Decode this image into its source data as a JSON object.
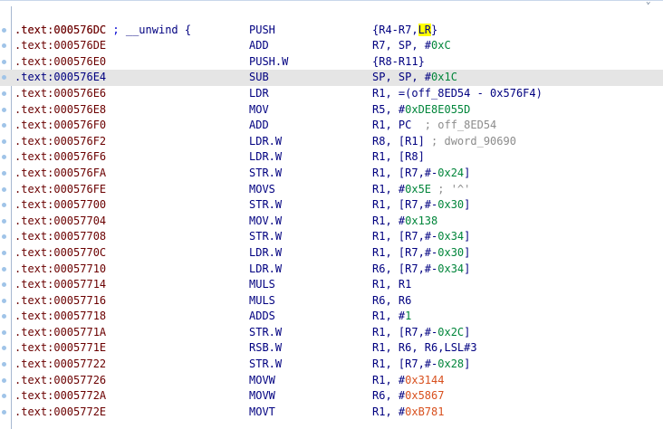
{
  "header_row": {
    "addr": ".text:000576DC",
    "sep": " ; ",
    "unwind": "__unwind {"
  },
  "rows": [
    {
      "addr": ".text:000576DC",
      "mnem": "PUSH",
      "op_a": "{R4-R7,",
      "op_lr": "LR",
      "op_b": "}"
    },
    {
      "addr": ".text:000576DE",
      "mnem": "ADD",
      "op_a": "R7, SP, #",
      "hex": "0xC"
    },
    {
      "addr": ".text:000576E0",
      "mnem": "PUSH.W",
      "op_a": "{R8-R11}"
    },
    {
      "addr": ".text:000576E4",
      "mnem": "SUB",
      "op_a": "SP, SP, #",
      "hex": "0x1C"
    },
    {
      "addr": ".text:000576E6",
      "mnem": "LDR",
      "op_a": "R1, =(off_8ED54 - 0x576F4)"
    },
    {
      "addr": ".text:000576E8",
      "mnem": "MOV",
      "op_a": "R5, #",
      "hex": "0xDE8E055D"
    },
    {
      "addr": ".text:000576F0",
      "mnem": "ADD",
      "op_a": "R1, PC",
      "comment": "  ; off_8ED54"
    },
    {
      "addr": ".text:000576F2",
      "mnem": "LDR.W",
      "op_a": "R8, [R1]",
      "comment": " ; dword_90690"
    },
    {
      "addr": ".text:000576F6",
      "mnem": "LDR.W",
      "op_a": "R1, [R8]"
    },
    {
      "addr": ".text:000576FA",
      "mnem": "STR.W",
      "op_a": "R1, [R7,#-",
      "hex": "0x24",
      "op_b": "]"
    },
    {
      "addr": ".text:000576FE",
      "mnem": "MOVS",
      "op_a": "R1, #",
      "hex": "0x5E",
      "comment": " ; '^'"
    },
    {
      "addr": ".text:00057700",
      "mnem": "STR.W",
      "op_a": "R1, [R7,#-",
      "hex": "0x30",
      "op_b": "]"
    },
    {
      "addr": ".text:00057704",
      "mnem": "MOV.W",
      "op_a": "R1, #",
      "hex": "0x138"
    },
    {
      "addr": ".text:00057708",
      "mnem": "STR.W",
      "op_a": "R1, [R7,#-",
      "hex": "0x34",
      "op_b": "]"
    },
    {
      "addr": ".text:0005770C",
      "mnem": "LDR.W",
      "op_a": "R1, [R7,#-",
      "hex": "0x30",
      "op_b": "]"
    },
    {
      "addr": ".text:00057710",
      "mnem": "LDR.W",
      "op_a": "R6, [R7,#-",
      "hex": "0x34",
      "op_b": "]"
    },
    {
      "addr": ".text:00057714",
      "mnem": "MULS",
      "op_a": "R1, R1"
    },
    {
      "addr": ".text:00057716",
      "mnem": "MULS",
      "op_a": "R6, R6"
    },
    {
      "addr": ".text:00057718",
      "mnem": "ADDS",
      "op_a": "R1, #",
      "hex": "1"
    },
    {
      "addr": ".text:0005771A",
      "mnem": "STR.W",
      "op_a": "R1, [R7,#-",
      "hex": "0x2C",
      "op_b": "]"
    },
    {
      "addr": ".text:0005771E",
      "mnem": "RSB.W",
      "op_a": "R1, R6, R6,LSL#3"
    },
    {
      "addr": ".text:00057722",
      "mnem": "STR.W",
      "op_a": "R1, [R7,#-",
      "hex": "0x28",
      "op_b": "]"
    },
    {
      "addr": ".text:00057726",
      "mnem": "MOVW",
      "op_a": "R1, #",
      "hex_red": "0x3144"
    },
    {
      "addr": ".text:0005772A",
      "mnem": "MOVW",
      "op_a": "R6, #",
      "hex_red": "0x5867"
    },
    {
      "addr": ".text:0005772E",
      "mnem": "MOVT",
      "op_a": "R1, #",
      "hex_red": "0xB781"
    }
  ],
  "colors": {
    "address": "#6b0000",
    "text": "#000080",
    "hex_immediate": "#00853a",
    "hex_highlighted": "#d8501e",
    "comment": "#8c8c8c",
    "current_line_bg": "#e5e5e5",
    "lr_highlight": "#ffff00"
  }
}
